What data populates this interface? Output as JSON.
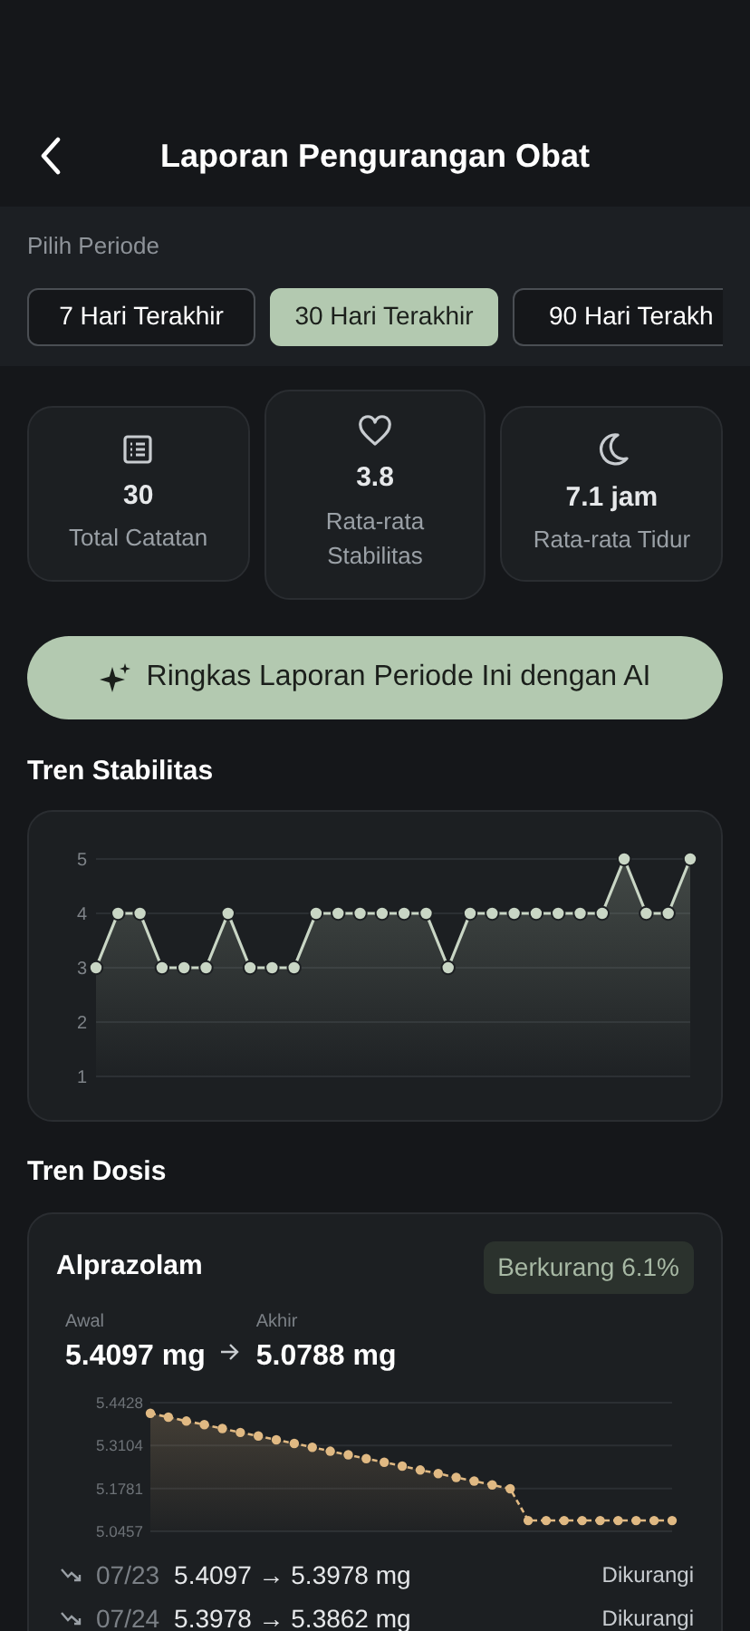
{
  "header": {
    "title": "Laporan Pengurangan Obat"
  },
  "period": {
    "label": "Pilih Periode",
    "options": [
      {
        "label": "7 Hari Terakhir",
        "selected": false
      },
      {
        "label": "30 Hari Terakhir",
        "selected": true
      },
      {
        "label": "90 Hari Terakh",
        "selected": false
      }
    ]
  },
  "stats": [
    {
      "kind": "list",
      "value": "30",
      "label": "Total Catatan"
    },
    {
      "kind": "heart",
      "value": "3.8",
      "label": "Rata-rata Stabilitas"
    },
    {
      "kind": "moon",
      "value": "7.1 jam",
      "label": "Rata-rata Tidur"
    }
  ],
  "ai_button": {
    "label": "Ringkas Laporan Periode Ini dengan AI"
  },
  "stability": {
    "title": "Tren Stabilitas",
    "chart_data": {
      "type": "area",
      "grid": true,
      "ylim": [
        1,
        5
      ],
      "yticks": [
        1,
        2,
        3,
        4,
        5
      ],
      "categories": [
        null,
        null,
        null,
        null,
        null,
        null,
        null,
        null,
        null,
        null,
        null,
        null,
        null,
        null,
        null,
        null,
        null,
        null,
        null,
        null,
        null,
        null,
        null,
        null,
        null,
        null,
        null,
        null
      ],
      "series": [
        {
          "color": "#c9d6c5",
          "values": [
            3,
            4,
            4,
            3,
            3,
            3,
            4,
            3,
            3,
            3,
            4,
            4,
            4,
            4,
            4,
            4,
            3,
            4,
            4,
            4,
            4,
            4,
            4,
            4,
            5,
            4,
            4,
            5
          ]
        }
      ]
    }
  },
  "dose": {
    "title": "Tren Dosis",
    "medications": [
      {
        "name": "Alprazolam",
        "badge": "Berkurang 6.1%",
        "start_label": "Awal",
        "start_value": "5.4097 mg",
        "end_label": "Akhir",
        "end_value": "5.0788 mg",
        "chart_data": {
          "type": "area",
          "grid": true,
          "ylim": [
            5.0457,
            5.4428
          ],
          "yticks": [
            {
              "value": 5.0457,
              "label": "5.0457"
            },
            {
              "value": 5.1781,
              "label": "5.1781"
            },
            {
              "value": 5.3104,
              "label": "5.3104"
            },
            {
              "value": 5.4428,
              "label": "5.4428"
            }
          ],
          "series": [
            {
              "color": "#e0b983",
              "values": [
                5.41,
                5.398,
                5.386,
                5.375,
                5.363,
                5.351,
                5.34,
                5.328,
                5.317,
                5.305,
                5.293,
                5.282,
                5.27,
                5.259,
                5.247,
                5.235,
                5.224,
                5.212,
                5.201,
                5.189,
                5.177,
                5.079,
                5.079,
                5.079,
                5.079,
                5.079,
                5.079,
                5.079,
                5.079,
                5.079
              ]
            }
          ]
        },
        "changes": [
          {
            "date": "07/23",
            "text": "5.4097 → 5.3978 mg",
            "status": "Dikurangi"
          },
          {
            "date": "07/24",
            "text": "5.3978 → 5.3862 mg",
            "status": "Dikurangi"
          }
        ]
      }
    ]
  }
}
